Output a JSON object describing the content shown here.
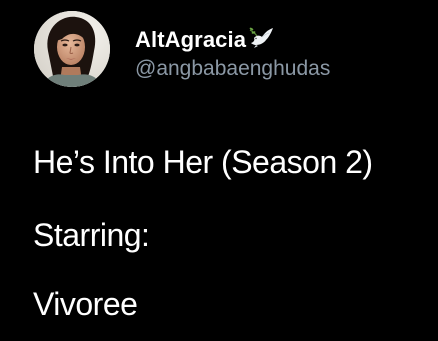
{
  "tweet": {
    "author": {
      "display_name": "AltAgracia",
      "handle": "@angbabaenghudas",
      "name_badge_icon": "dove-icon",
      "avatar": "avatar"
    },
    "text_lines": [
      "He’s Into Her (Season 2)",
      "Starring:",
      "Vivoree"
    ]
  },
  "colors": {
    "background": "#000000",
    "primary_text": "#ffffff",
    "secondary_text": "#8b98a5"
  }
}
